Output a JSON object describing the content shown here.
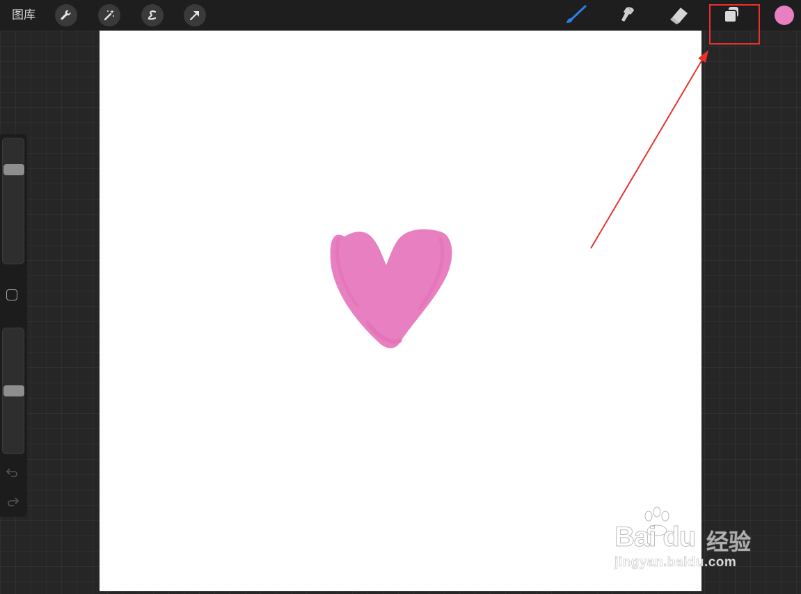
{
  "topbar": {
    "gallery_label": "图库",
    "left_tools": [
      "wrench-icon",
      "magic-wand-icon",
      "selection-s-icon",
      "transform-arrow-icon"
    ],
    "right_tools": [
      "brush-icon",
      "smudge-icon",
      "eraser-icon",
      "layers-icon"
    ],
    "active_tool": "brush-icon",
    "current_color": "#e87fc0"
  },
  "annotation": {
    "highlight_target": "layers-icon",
    "highlight_color": "#e8322c"
  },
  "sidebar": {
    "controls": [
      "brush-size-slider",
      "modify-button",
      "opacity-slider",
      "undo-icon",
      "redo-icon"
    ]
  },
  "canvas": {
    "background": "#ffffff",
    "drawing": "pink heart",
    "drawing_color": "#e87fc0"
  },
  "watermark": {
    "brand": "Bai  du",
    "brand_cn": "经验",
    "url": "jingyan.baidu.com"
  }
}
